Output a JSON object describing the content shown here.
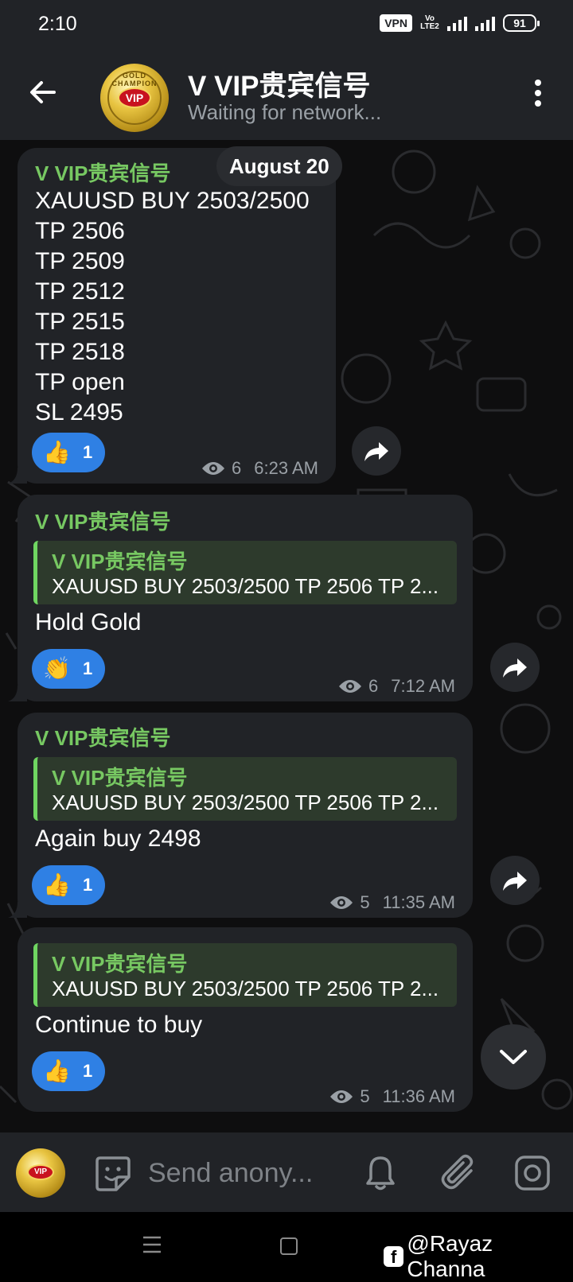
{
  "status_bar": {
    "time": "2:10",
    "vpn": "VPN",
    "volte": "Vo LTE2",
    "battery": "91"
  },
  "header": {
    "title": "V VIP贵宾信号",
    "status": "Waiting for network...",
    "avatar_badge": "VIP",
    "avatar_ring_text": "GOLD CHAMPION"
  },
  "chat": {
    "date_chip": "August 20",
    "messages": [
      {
        "sender": "V VIP贵宾信号",
        "text": "XAUUSD BUY 2503/2500\nTP 2506\nTP 2509\nTP 2512\nTP 2515\nTP 2518\nTP open\nSL 2495",
        "reaction_emoji": "👍",
        "reaction_count": "1",
        "views": "6",
        "time": "6:23 AM"
      },
      {
        "sender": "V VIP贵宾信号",
        "reply_name": "V VIP贵宾信号",
        "reply_text": "XAUUSD BUY 2503/2500 TP 2506 TP 2...",
        "text": "Hold Gold",
        "reaction_emoji": "👏",
        "reaction_count": "1",
        "views": "6",
        "time": "7:12 AM"
      },
      {
        "sender": "V VIP贵宾信号",
        "reply_name": "V VIP贵宾信号",
        "reply_text": "XAUUSD BUY 2503/2500 TP 2506 TP 2...",
        "text": "Again buy 2498",
        "reaction_emoji": "👍",
        "reaction_count": "1",
        "views": "5",
        "time": "11:35 AM"
      },
      {
        "reply_name": "V VIP贵宾信号",
        "reply_text": "XAUUSD BUY 2503/2500 TP 2506 TP 2...",
        "text": "Continue to buy",
        "reaction_emoji": "👍",
        "reaction_count": "1",
        "views": "5",
        "time": "11:36 AM"
      }
    ]
  },
  "input_bar": {
    "placeholder": "Send anony...",
    "avatar_badge": "VIP"
  },
  "watermark": {
    "fb_icon": "f",
    "text": "@Rayaz Channa"
  },
  "colors": {
    "header_bg": "#212327",
    "bubble_bg": "#212327",
    "sender_green": "#77c862",
    "reaction_blue": "#2f80e4",
    "reply_bar": "#6fd661"
  }
}
